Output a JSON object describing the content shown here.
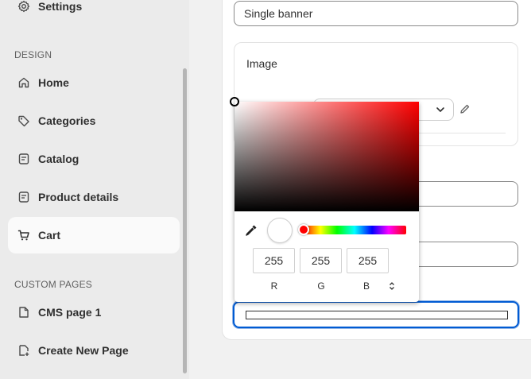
{
  "sidebar": {
    "top_item": {
      "label": "Settings",
      "icon": "gear-icon"
    },
    "design_section": "DESIGN",
    "design_items": [
      {
        "label": "Home",
        "icon": "home-icon"
      },
      {
        "label": "Categories",
        "icon": "tag-icon"
      },
      {
        "label": "Catalog",
        "icon": "document-icon"
      },
      {
        "label": "Product details",
        "icon": "document-icon"
      },
      {
        "label": "Cart",
        "icon": "cart-icon",
        "active": true
      }
    ],
    "custom_section": "CUSTOM PAGES",
    "custom_items": [
      {
        "label": "CMS page 1",
        "icon": "page-icon"
      },
      {
        "label": "Create New Page",
        "icon": "new-page-icon"
      }
    ]
  },
  "form": {
    "title_value": "Single banner",
    "image_label": "Image"
  },
  "color_picker": {
    "r": "255",
    "g": "255",
    "b": "255",
    "r_label": "R",
    "g_label": "G",
    "b_label": "B",
    "selected_color": "#ffffff",
    "hue_color": "#ff0000"
  },
  "colors": {
    "focus_ring": "#005bd3",
    "sidebar_bg": "#ebebeb",
    "active_bg": "#fafafa"
  }
}
